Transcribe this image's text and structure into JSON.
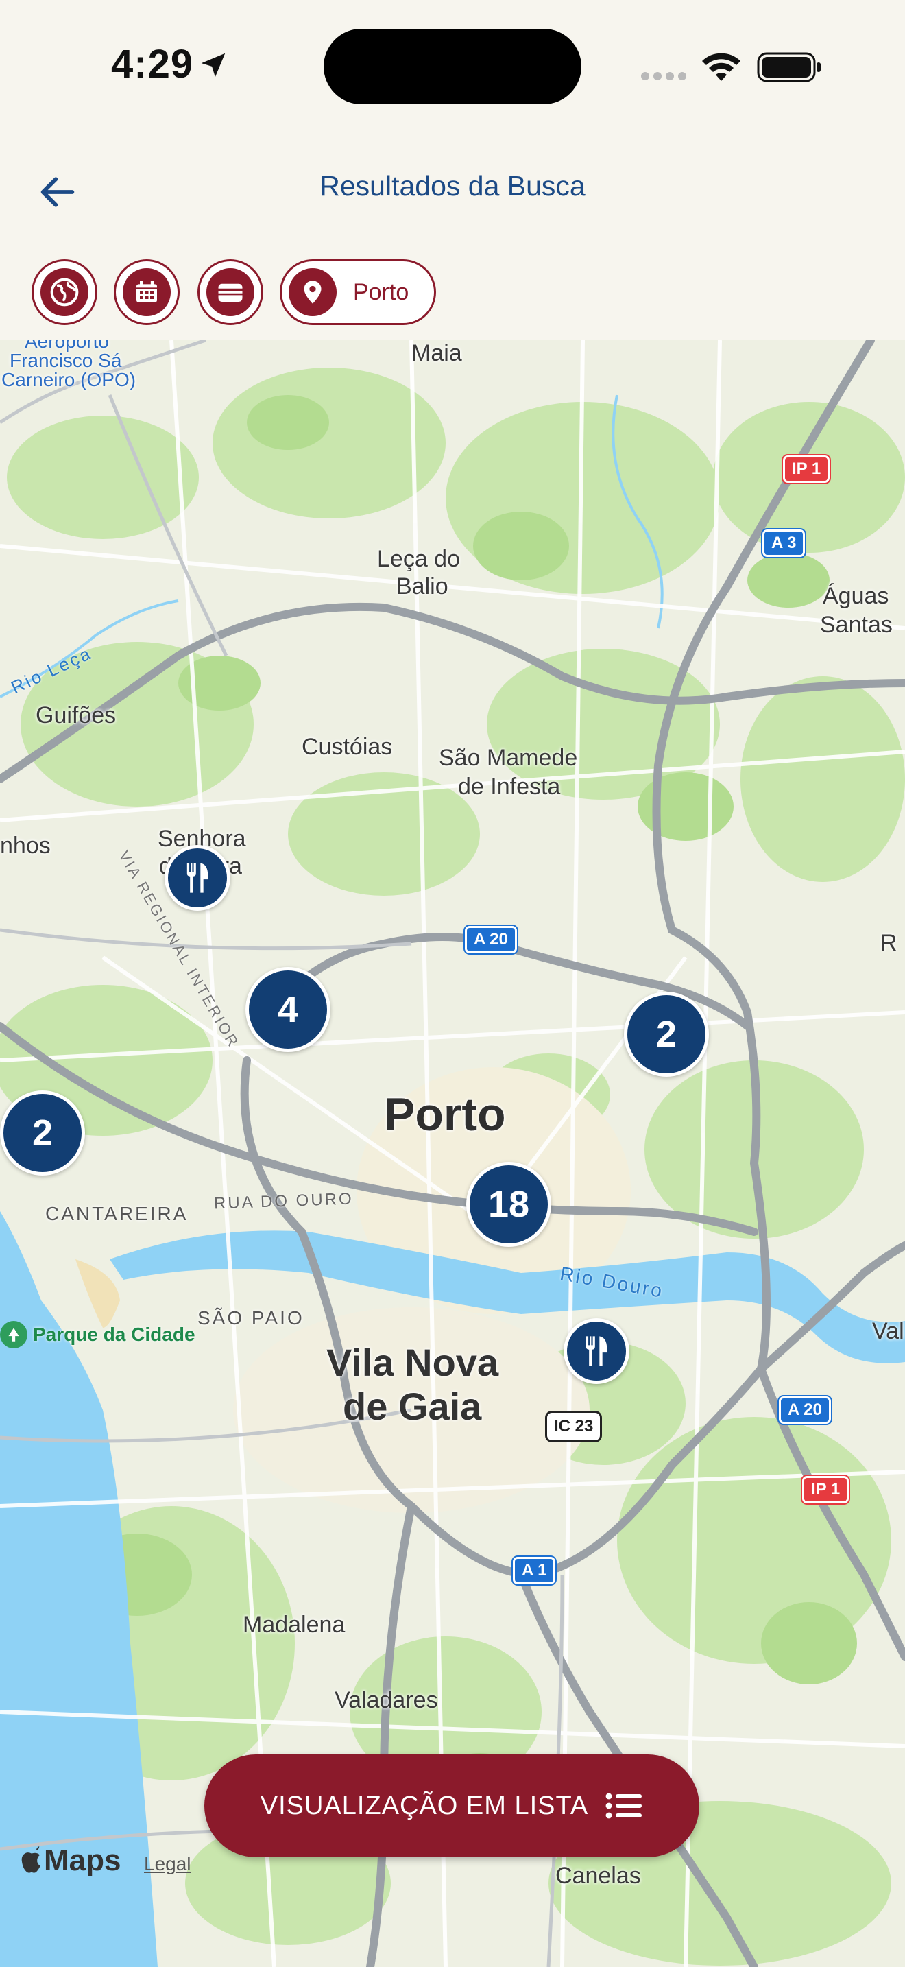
{
  "status_bar": {
    "time": "4:29"
  },
  "header": {
    "title": "Resultados da Busca"
  },
  "filters": {
    "location_label": "Porto"
  },
  "map": {
    "places": {
      "maia": "Maia",
      "aeroporto": "Aeroporto",
      "francisco": "Francisco Sá",
      "carneiro": "Carneiro (OPO)",
      "leca": "Leça do",
      "balio": "Balio",
      "aguas": "Águas",
      "santas": "Santas",
      "guifoes": "Guifões",
      "custoias": "Custóias",
      "sao_mamede": "São Mamede",
      "de_infesta": "de Infesta",
      "senhora": "Senhora",
      "hora": "da Hora",
      "nhos": "nhos",
      "parque": "Parque da Cidade",
      "porto": "Porto",
      "cantareira": "CANTAREIRA",
      "rua_ouro": "RUA DO OURO",
      "rio_douro": "Rio Douro",
      "sao_paio": "SÃO PAIO",
      "vila_nova": "Vila Nova",
      "de_gaia": "de Gaia",
      "madalena": "Madalena",
      "valadares": "Valadares",
      "canelas": "Canelas",
      "val": "Val",
      "r": "R",
      "via_regional": "VIA REGIONAL INTERIOR",
      "rio_leca": "Rio Leça"
    },
    "shields": {
      "ip1_top": "IP 1",
      "a3": "A 3",
      "a20_top": "A 20",
      "a20_right": "A 20",
      "ip1_bottom": "IP 1",
      "ic23": "IC 23",
      "a1": "A 1"
    },
    "clusters": {
      "c4": "4",
      "c2_right": "2",
      "c2_left": "2",
      "c18": "18"
    },
    "attribution": {
      "maps": "Maps",
      "legal": "Legal"
    }
  },
  "list_button": {
    "label": "VISUALIZAÇÃO EM LISTA"
  },
  "colors": {
    "brand": "#8b1a2b",
    "marker": "#123e73",
    "title": "#1c4a86"
  },
  "icons": [
    "location-arrow-icon",
    "wifi-icon",
    "battery-icon",
    "back-arrow-icon",
    "globe-icon",
    "calendar-icon",
    "wallet-icon",
    "map-pin-icon",
    "restaurant-icon",
    "list-icon",
    "apple-icon"
  ]
}
